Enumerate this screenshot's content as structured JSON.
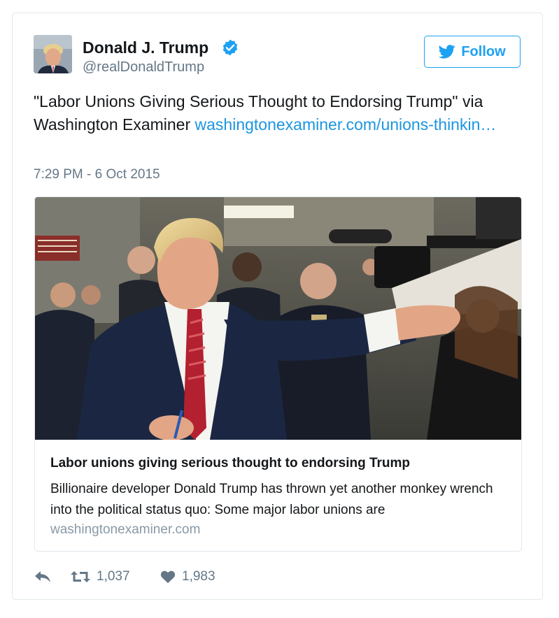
{
  "colors": {
    "accent": "#1da1f2",
    "link": "#1b95e0",
    "muted": "#657786",
    "border": "#e1e8ed"
  },
  "author": {
    "name": "Donald J. Trump",
    "handle": "@realDonaldTrump",
    "verified_icon": "verified-badge-icon",
    "avatar": "profile-photo"
  },
  "follow_button": {
    "label": "Follow",
    "icon": "twitter-bird-icon"
  },
  "tweet": {
    "text": "\"Labor Unions Giving Serious Thought to Endorsing Trump\" via Washington Examiner ",
    "link_text": "washingtonexaminer.com/unions-thinkin…",
    "timestamp": "7:29 PM - 6 Oct 2015"
  },
  "card": {
    "image": "news-photo",
    "title": "Labor unions giving serious thought to endorsing Trump",
    "description": "Billionaire developer Donald Trump has thrown yet another monkey wrench into the political status quo: Some major labor unions are",
    "domain": "washingtonexaminer.com"
  },
  "actions": {
    "reply_icon": "reply-icon",
    "retweet_icon": "retweet-icon",
    "retweet_count": "1,037",
    "like_icon": "heart-icon",
    "like_count": "1,983"
  }
}
